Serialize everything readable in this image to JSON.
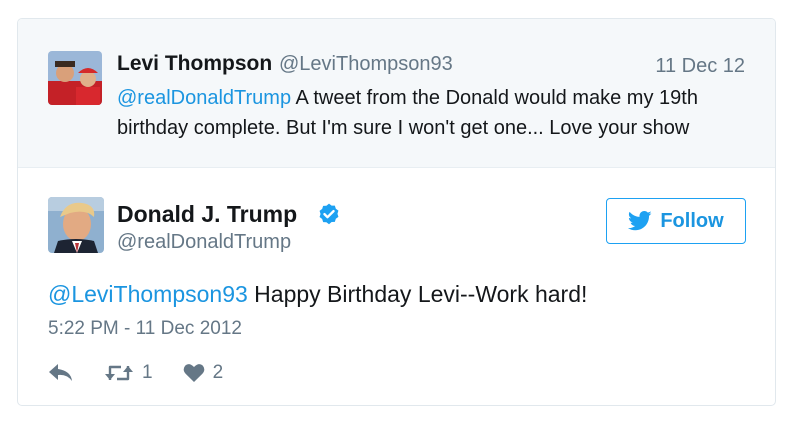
{
  "parent_tweet": {
    "name": "Levi Thompson",
    "handle": "@LeviThompson93",
    "date": "11 Dec 12",
    "mention": "@realDonaldTrump",
    "text": " A tweet from the Donald would make my 19th birthday complete. But I'm sure I won't get one... Love your show"
  },
  "main_tweet": {
    "name": "Donald J. Trump",
    "handle": "@realDonaldTrump",
    "follow_label": "Follow",
    "mention": "@LeviThompson93",
    "text": " Happy Birthday Levi--Work hard!",
    "timestamp": "5:22 PM - 11 Dec 2012",
    "retweet_count": "1",
    "like_count": "2"
  },
  "colors": {
    "link": "#1b95e0",
    "muted": "#657786",
    "text": "#14171a",
    "parent_bg": "#f5f8fa",
    "verified": "#1da1f2"
  },
  "icons": {
    "reply": "reply-icon",
    "retweet": "retweet-icon",
    "like": "heart-icon",
    "verified": "verified-badge-icon",
    "bird": "twitter-bird-icon"
  }
}
